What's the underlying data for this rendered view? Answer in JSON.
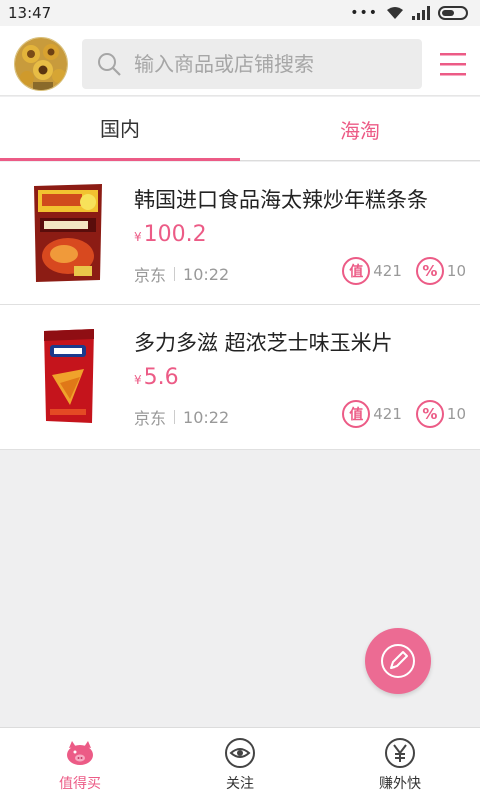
{
  "status_bar": {
    "time": "13:47",
    "dots": "•••"
  },
  "search": {
    "placeholder": "输入商品或店铺搜索"
  },
  "tabs": [
    {
      "label": "国内",
      "active": true
    },
    {
      "label": "海淘",
      "active": false
    }
  ],
  "products": [
    {
      "title": "韩国进口食品海太辣炒年糕条条",
      "currency": "¥",
      "price": "100.2",
      "source": "京东",
      "time": "10:22",
      "worth_count": "421",
      "discount_count": "10"
    },
    {
      "title": "多力多滋 超浓芝士味玉米片",
      "currency": "¥",
      "price": "5.6",
      "source": "京东",
      "time": "10:22",
      "worth_count": "421",
      "discount_count": "10"
    }
  ],
  "stat_icons": {
    "worth": "值",
    "discount": "%"
  },
  "bottom_nav": [
    {
      "label": "值得买",
      "icon": "pig-icon",
      "active": true
    },
    {
      "label": "关注",
      "icon": "eye-icon",
      "active": false
    },
    {
      "label": "赚外快",
      "icon": "yen-coin-icon",
      "active": false
    }
  ],
  "colors": {
    "accent": "#ec5b86",
    "fab": "#ec6b93"
  }
}
